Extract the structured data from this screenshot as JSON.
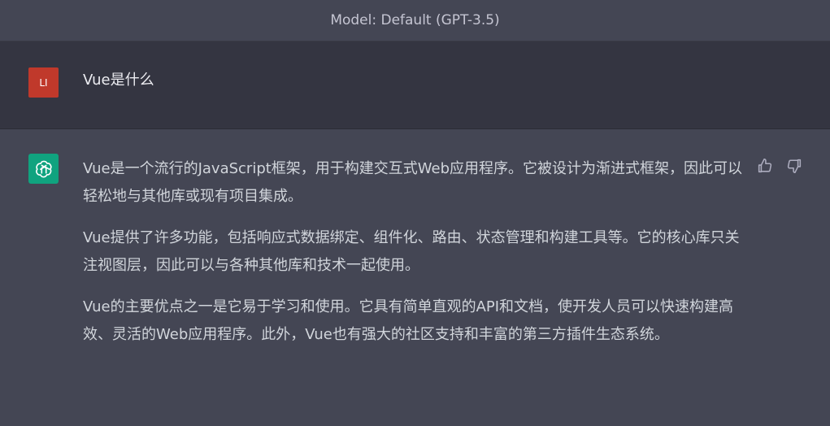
{
  "header": {
    "model_label": "Model: Default (GPT-3.5)"
  },
  "user_message": {
    "avatar_text": "LI",
    "text": "Vue是什么"
  },
  "assistant_message": {
    "paragraphs": [
      "Vue是一个流行的JavaScript框架，用于构建交互式Web应用程序。它被设计为渐进式框架，因此可以轻松地与其他库或现有项目集成。",
      "Vue提供了许多功能，包括响应式数据绑定、组件化、路由、状态管理和构建工具等。它的核心库只关注视图层，因此可以与各种其他库和技术一起使用。",
      "Vue的主要优点之一是它易于学习和使用。它具有简单直观的API和文档，使开发人员可以快速构建高效、灵活的Web应用程序。此外，Vue也有强大的社区支持和丰富的第三方插件生态系统。"
    ]
  },
  "icons": {
    "avatar_bot": "openai-logo-icon",
    "feedback_up": "thumbs-up-icon",
    "feedback_down": "thumbs-down-icon"
  },
  "colors": {
    "user_avatar": "#c0392b",
    "bot_avatar": "#10a37f",
    "user_row_bg": "#343541",
    "assistant_row_bg": "#444654"
  }
}
